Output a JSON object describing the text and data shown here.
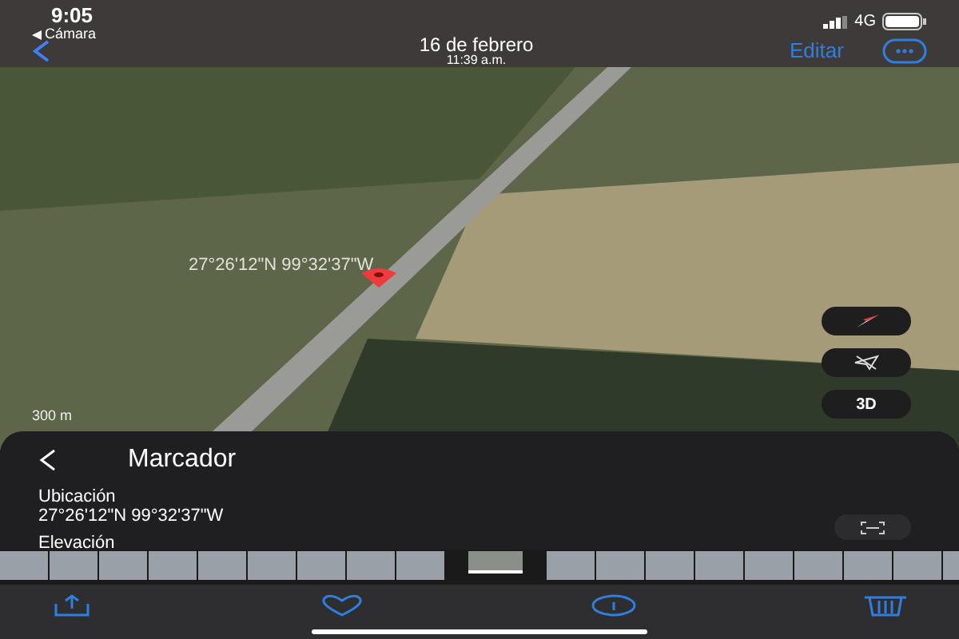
{
  "status_bar": {
    "time": "9:05",
    "back_app": "Cámara",
    "network": "4G"
  },
  "nav_bar": {
    "title": "16 de febrero",
    "subtitle": "11:39 a.m.",
    "edit": "Editar"
  },
  "map": {
    "coordinate_label": "27°26'12\"N 99°32'37\"W",
    "scale_label": "300 m",
    "view_button": "3D"
  },
  "panel": {
    "title": "Marcador",
    "location_label": "Ubicación",
    "location_value": "27°26'12\"N 99°32'37\"W",
    "elevation_label": "Elevación"
  },
  "thumbnails": [
    {
      "selected": false
    },
    {
      "selected": false
    },
    {
      "selected": false
    },
    {
      "selected": false
    },
    {
      "selected": false
    },
    {
      "selected": false
    },
    {
      "selected": false
    },
    {
      "selected": false
    },
    {
      "selected": false
    },
    {
      "selected": true
    },
    {
      "selected": false
    },
    {
      "selected": false
    },
    {
      "selected": false
    },
    {
      "selected": false
    },
    {
      "selected": false
    },
    {
      "selected": false
    },
    {
      "selected": false
    },
    {
      "selected": false
    },
    {
      "selected": false
    }
  ]
}
